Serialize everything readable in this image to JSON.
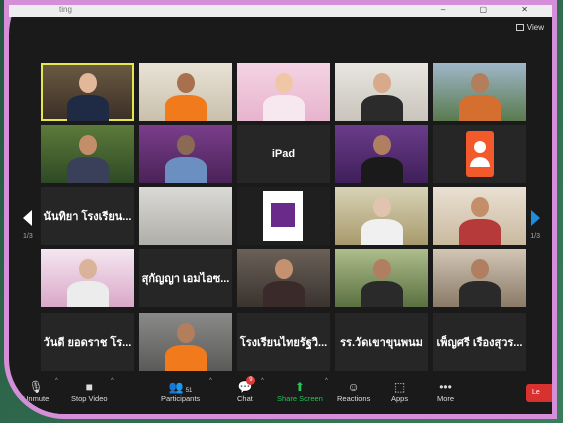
{
  "window": {
    "title": "ting",
    "view_label": "View"
  },
  "tiles": [
    {
      "kind": "video",
      "scene": "office",
      "active": true
    },
    {
      "kind": "video",
      "scene": "orange"
    },
    {
      "kind": "video",
      "scene": "pink-woman"
    },
    {
      "kind": "video",
      "scene": "woman-room"
    },
    {
      "kind": "video",
      "scene": "city-man"
    },
    {
      "kind": "video",
      "scene": "phone-woman"
    },
    {
      "kind": "video",
      "scene": "hijab"
    },
    {
      "kind": "name",
      "label": "iPad"
    },
    {
      "kind": "video",
      "scene": "banner"
    },
    {
      "kind": "avatar",
      "color": "#f25a2b"
    },
    {
      "kind": "name",
      "label": "นันทิยา โรงเรียน..."
    },
    {
      "kind": "video",
      "scene": "empty-room"
    },
    {
      "kind": "video",
      "scene": "psu-logo"
    },
    {
      "kind": "video",
      "scene": "mask-room"
    },
    {
      "kind": "video",
      "scene": "woman-class"
    },
    {
      "kind": "video",
      "scene": "pink-poster"
    },
    {
      "kind": "name",
      "label": "สุกัญญา เอมไอซ..."
    },
    {
      "kind": "video",
      "scene": "woman-indoor"
    },
    {
      "kind": "video",
      "scene": "woman-outdoor"
    },
    {
      "kind": "video",
      "scene": "man-room"
    },
    {
      "kind": "name",
      "label": "วันดี ยอดราช โร..."
    },
    {
      "kind": "video",
      "scene": "young-man"
    },
    {
      "kind": "name",
      "label": "โรงเรียนไทยรัฐวิ..."
    },
    {
      "kind": "name",
      "label": "รร.วัดเขาขุนพนม"
    },
    {
      "kind": "name",
      "label": "เพ็ญศรี เรืองสุวร..."
    }
  ],
  "pager": {
    "left": "1/3",
    "right": "1/3"
  },
  "toolbar": {
    "unmute": "Unmute",
    "stop_video": "Stop Video",
    "participants": "Participants",
    "participants_count": "51",
    "chat": "Chat",
    "chat_badge": "9",
    "share": "Share Screen",
    "reactions": "Reactions",
    "apps": "Apps",
    "more": "More",
    "leave": "Le"
  },
  "colors": {
    "frame": "#d58fd8",
    "share": "#25c35a",
    "leave": "#d93030",
    "next": "#1f8ce0",
    "active": "#e5e84a"
  }
}
